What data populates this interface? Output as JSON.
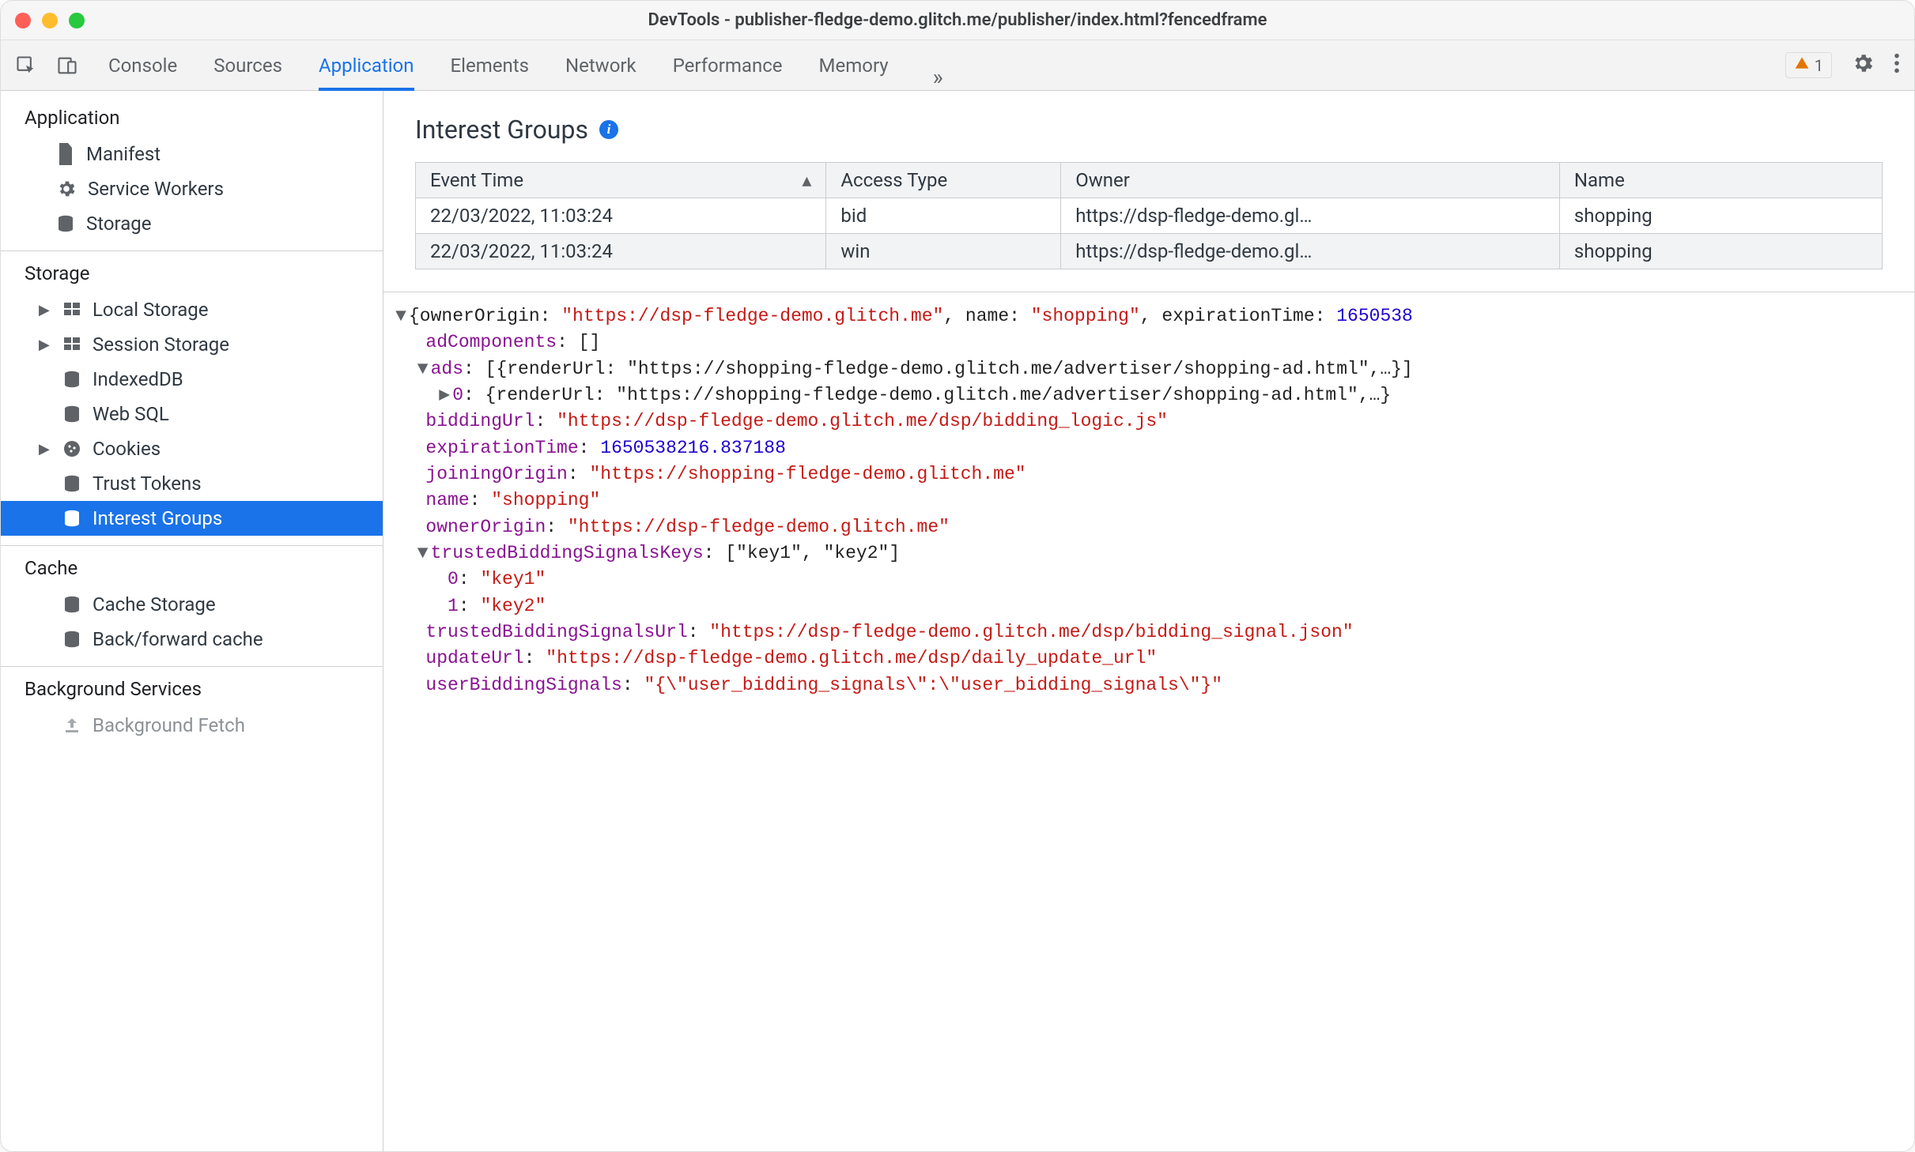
{
  "window": {
    "title": "DevTools - publisher-fledge-demo.glitch.me/publisher/index.html?fencedframe"
  },
  "tabs": {
    "items": [
      "Console",
      "Sources",
      "Application",
      "Elements",
      "Network",
      "Performance",
      "Memory"
    ],
    "active": "Application",
    "more": "»",
    "issues_count": "1"
  },
  "sidebar": {
    "application": {
      "header": "Application",
      "items": [
        "Manifest",
        "Service Workers",
        "Storage"
      ]
    },
    "storage": {
      "header": "Storage",
      "items": [
        "Local Storage",
        "Session Storage",
        "IndexedDB",
        "Web SQL",
        "Cookies",
        "Trust Tokens",
        "Interest Groups"
      ]
    },
    "cache": {
      "header": "Cache",
      "items": [
        "Cache Storage",
        "Back/forward cache"
      ]
    },
    "background": {
      "header": "Background Services",
      "items": [
        "Background Fetch"
      ]
    }
  },
  "panel": {
    "title": "Interest Groups",
    "columns": [
      "Event Time",
      "Access Type",
      "Owner",
      "Name"
    ],
    "rows": [
      {
        "time": "22/03/2022, 11:03:24",
        "type": "bid",
        "owner": "https://dsp-fledge-demo.gl…",
        "name": "shopping"
      },
      {
        "time": "22/03/2022, 11:03:24",
        "type": "win",
        "owner": "https://dsp-fledge-demo.gl…",
        "name": "shopping"
      }
    ]
  },
  "detail": {
    "root_prefix": "{ownerOrigin: ",
    "root_owner": "\"https://dsp-fledge-demo.glitch.me\"",
    "root_mid": ", name: ",
    "root_name": "\"shopping\"",
    "root_mid2": ", expirationTime: ",
    "root_exp": "1650538",
    "adComponents_key": "adComponents",
    "adComponents_val": "[]",
    "ads_key": "ads",
    "ads_val": "[{renderUrl: \"https://shopping-fledge-demo.glitch.me/advertiser/shopping-ad.html\",…}]",
    "ads_0": "{renderUrl: \"https://shopping-fledge-demo.glitch.me/advertiser/shopping-ad.html\",…}",
    "biddingUrl_key": "biddingUrl",
    "biddingUrl_val": "\"https://dsp-fledge-demo.glitch.me/dsp/bidding_logic.js\"",
    "expirationTime_key": "expirationTime",
    "expirationTime_val": "1650538216.837188",
    "joiningOrigin_key": "joiningOrigin",
    "joiningOrigin_val": "\"https://shopping-fledge-demo.glitch.me\"",
    "name_key": "name",
    "name_val": "\"shopping\"",
    "ownerOrigin_key": "ownerOrigin",
    "ownerOrigin_val": "\"https://dsp-fledge-demo.glitch.me\"",
    "tbsk_key": "trustedBiddingSignalsKeys",
    "tbsk_val": "[\"key1\", \"key2\"]",
    "tbsk_0_key": "0",
    "tbsk_0_val": "\"key1\"",
    "tbsk_1_key": "1",
    "tbsk_1_val": "\"key2\"",
    "tbsu_key": "trustedBiddingSignalsUrl",
    "tbsu_val": "\"https://dsp-fledge-demo.glitch.me/dsp/bidding_signal.json\"",
    "updateUrl_key": "updateUrl",
    "updateUrl_val": "\"https://dsp-fledge-demo.glitch.me/dsp/daily_update_url\"",
    "userBiddingSignals_key": "userBiddingSignals",
    "userBiddingSignals_val": "\"{\\\"user_bidding_signals\\\":\\\"user_bidding_signals\\\"}\""
  }
}
